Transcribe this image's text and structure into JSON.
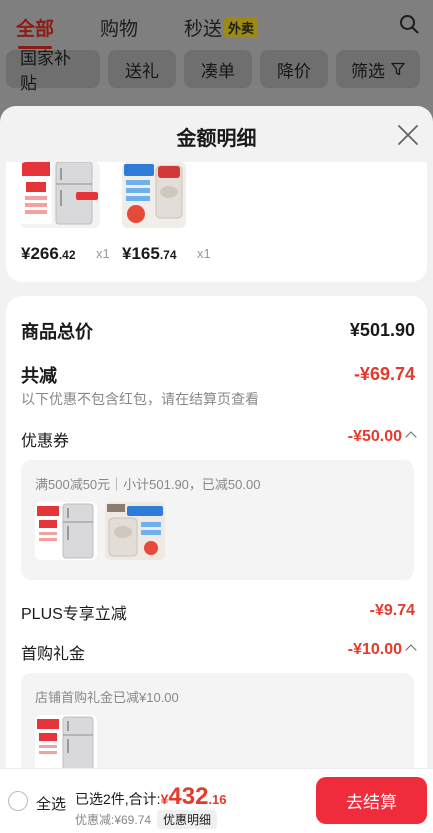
{
  "background": {
    "tabs": [
      {
        "label": "全部"
      },
      {
        "label": "购物"
      },
      {
        "label": "秒送",
        "badge": "外卖"
      }
    ],
    "chips": [
      "国家补贴",
      "送礼",
      "凑单",
      "降价",
      "筛选"
    ],
    "search_icon": "search-icon",
    "filter_icon": "funnel-icon"
  },
  "sheet": {
    "title": "金额明细",
    "close_icon": "close-icon",
    "products": [
      {
        "price_int": "¥266",
        "price_dec": ".42",
        "qty": "x1",
        "image": "fridge-product-image"
      },
      {
        "price_int": "¥165",
        "price_dec": ".74",
        "qty": "x1",
        "image": "washing-machine-product-image"
      }
    ],
    "summary": {
      "total_label": "商品总价",
      "total_value": "¥501.90",
      "reduce_label": "共减",
      "reduce_value": "-¥69.74",
      "reduce_note": "以下优惠不包含红包，请在结算页查看",
      "coupon_label": "优惠券",
      "coupon_value": "-¥50.00",
      "coupon_detail": "满500减50元｜小计501.90，已减50.00",
      "plus_label": "PLUS专享立减",
      "plus_value": "-¥9.74",
      "first_label": "首购礼金",
      "first_value": "-¥10.00",
      "first_detail": "店铺首购礼金已减¥10.00"
    }
  },
  "bottom": {
    "select_all": "全选",
    "selected_prefix": "已选2件,合计:",
    "total_cny": "¥",
    "total_int": "432",
    "total_dec": ".16",
    "saved": "优惠减:¥69.74",
    "detail_button": "优惠明细",
    "checkout": "去结算"
  },
  "colors": {
    "accent_red": "#e33a2c",
    "checkout_red": "#f02b3b",
    "overlay": "#7f7f7f"
  }
}
